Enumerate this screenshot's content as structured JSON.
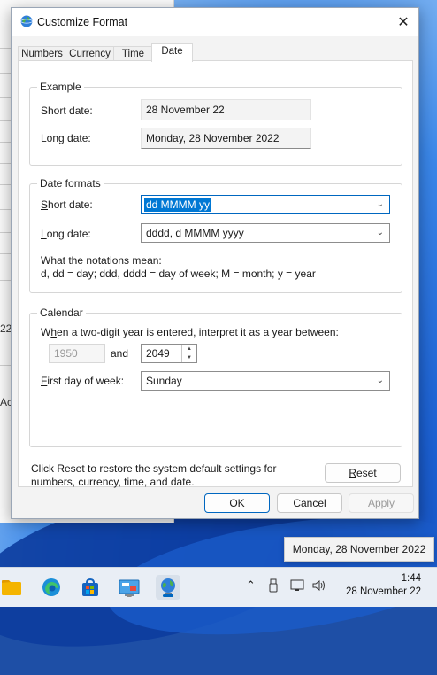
{
  "background_window": {
    "fragments": [
      "22",
      "Ac"
    ]
  },
  "dialog": {
    "title": "Customize Format",
    "tabs": [
      {
        "label": "Numbers"
      },
      {
        "label": "Currency"
      },
      {
        "label": "Time"
      },
      {
        "label": "Date",
        "active": true
      }
    ],
    "example": {
      "legend": "Example",
      "short_label": "Short date:",
      "short_value": "28 November 22",
      "long_label": "Long date:",
      "long_value": "Monday, 28 November 2022"
    },
    "date_formats": {
      "legend": "Date formats",
      "short_label": "Short date:",
      "short_value": "dd MMMM yy",
      "long_label": "Long date:",
      "long_value": "dddd, d MMMM yyyy",
      "notation_title": "What the notations mean:",
      "notation_text": "d, dd = day;  ddd, dddd = day of week;  M = month;  y = year"
    },
    "calendar": {
      "legend": "Calendar",
      "two_digit_label": "When a two-digit year is entered, interpret it as a year between:",
      "year_from": "1950",
      "and_label": "and",
      "year_to": "2049",
      "first_day_label": "First day of week:",
      "first_day_value": "Sunday"
    },
    "reset_text": "Click Reset to restore the system default settings for numbers, currency, time, and date.",
    "reset_button": "Reset",
    "ok_button": "OK",
    "cancel_button": "Cancel",
    "apply_button": "Apply"
  },
  "tooltip": "Monday, 28 November 2022",
  "taskbar": {
    "apps": [
      "file-explorer",
      "edge",
      "microsoft-store",
      "control-panel",
      "region-settings"
    ],
    "time": "1:44",
    "date": "28 November 22"
  },
  "colors": {
    "accent": "#0067c0",
    "selection": "#0078d4"
  }
}
